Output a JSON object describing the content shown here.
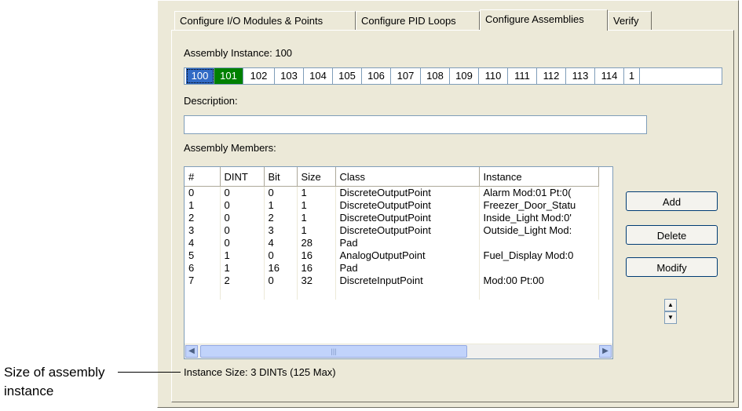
{
  "tabs": [
    {
      "label": "Configure I/O Modules & Points",
      "active": false
    },
    {
      "label": "Configure PID Loops",
      "active": false
    },
    {
      "label": "Configure Assemblies",
      "active": true
    },
    {
      "label": "Verify",
      "active": false
    }
  ],
  "assembly_instance": {
    "label": "Assembly Instance:",
    "value": "100"
  },
  "instances": [
    "100",
    "101",
    "102",
    "103",
    "104",
    "105",
    "106",
    "107",
    "108",
    "109",
    "110",
    "111",
    "112",
    "113",
    "114",
    "1"
  ],
  "instance_selected_blue": "100",
  "instance_selected_green": "101",
  "description": {
    "label": "Description:",
    "value": ""
  },
  "members": {
    "label": "Assembly Members:",
    "columns": [
      "#",
      "DINT",
      "Bit",
      "Size",
      "Class",
      "Instance"
    ],
    "rows": [
      [
        "0",
        "0",
        "0",
        "1",
        "DiscreteOutputPoint",
        "Alarm  Mod:01  Pt:0("
      ],
      [
        "1",
        "0",
        "1",
        "1",
        "DiscreteOutputPoint",
        "Freezer_Door_Statu"
      ],
      [
        "2",
        "0",
        "2",
        "1",
        "DiscreteOutputPoint",
        "Inside_Light  Mod:0'"
      ],
      [
        "3",
        "0",
        "3",
        "1",
        "DiscreteOutputPoint",
        "Outside_Light  Mod:"
      ],
      [
        "4",
        "0",
        "4",
        "28",
        "Pad",
        ""
      ],
      [
        "5",
        "1",
        "0",
        "16",
        "AnalogOutputPoint",
        "Fuel_Display  Mod:0"
      ],
      [
        "6",
        "1",
        "16",
        "16",
        "Pad",
        ""
      ],
      [
        "7",
        "2",
        "0",
        "32",
        "DiscreteInputPoint",
        "Mod:00  Pt:00"
      ]
    ]
  },
  "buttons": {
    "add": "Add",
    "delete": "Delete",
    "modify": "Modify"
  },
  "instance_size": "Instance Size: 3 DINTs  (125 Max)",
  "callout": {
    "line1": "Size of assembly",
    "line2": "instance"
  },
  "colors": {
    "selected_blue": "#316ac5",
    "selected_green": "#008000",
    "dialog_bg": "#ece9d8"
  }
}
